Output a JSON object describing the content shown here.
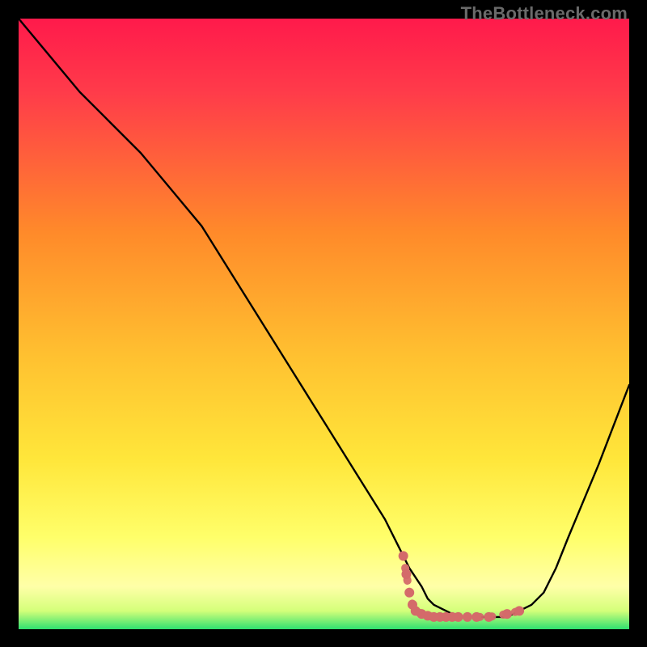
{
  "watermark": "TheBottleneck.com",
  "colors": {
    "bg": "#000000",
    "gradient_top": "#ff1a4b",
    "gradient_mid1": "#ff8a2a",
    "gradient_mid2": "#ffe63a",
    "gradient_mid3": "#ffff8a",
    "gradient_bottom": "#2fe070",
    "curve": "#000000",
    "marker_fill": "#d46a6a",
    "marker_stroke": "#b44f4f"
  },
  "chart_data": {
    "type": "line",
    "title": "",
    "xlabel": "",
    "ylabel": "",
    "xlim": [
      0,
      100
    ],
    "ylim": [
      0,
      100
    ],
    "series": [
      {
        "name": "bottleneck-curve",
        "x": [
          0,
          5,
          10,
          15,
          20,
          25,
          30,
          35,
          40,
          45,
          50,
          55,
          60,
          62,
          64,
          66,
          67,
          68,
          70,
          72,
          74,
          76,
          78,
          80,
          82,
          84,
          86,
          88,
          90,
          95,
          100
        ],
        "y": [
          100,
          94,
          88,
          83,
          78,
          72,
          66,
          58,
          50,
          42,
          34,
          26,
          18,
          14,
          10,
          7,
          5,
          4,
          3,
          2,
          2,
          2,
          2,
          2,
          3,
          4,
          6,
          10,
          15,
          27,
          40
        ]
      }
    ],
    "markers": {
      "name": "highlighted-range",
      "points": [
        {
          "x": 63,
          "y": 12
        },
        {
          "x": 63.5,
          "y": 9
        },
        {
          "x": 64,
          "y": 6
        },
        {
          "x": 64.5,
          "y": 4
        },
        {
          "x": 65,
          "y": 3
        },
        {
          "x": 66,
          "y": 2.5
        },
        {
          "x": 67,
          "y": 2.2
        },
        {
          "x": 68,
          "y": 2
        },
        {
          "x": 69,
          "y": 2
        },
        {
          "x": 70,
          "y": 2
        },
        {
          "x": 71,
          "y": 2
        },
        {
          "x": 72,
          "y": 2
        },
        {
          "x": 73.5,
          "y": 2
        },
        {
          "x": 75,
          "y": 2
        },
        {
          "x": 77,
          "y": 2
        },
        {
          "x": 80,
          "y": 2.5
        },
        {
          "x": 82,
          "y": 3
        }
      ]
    }
  }
}
